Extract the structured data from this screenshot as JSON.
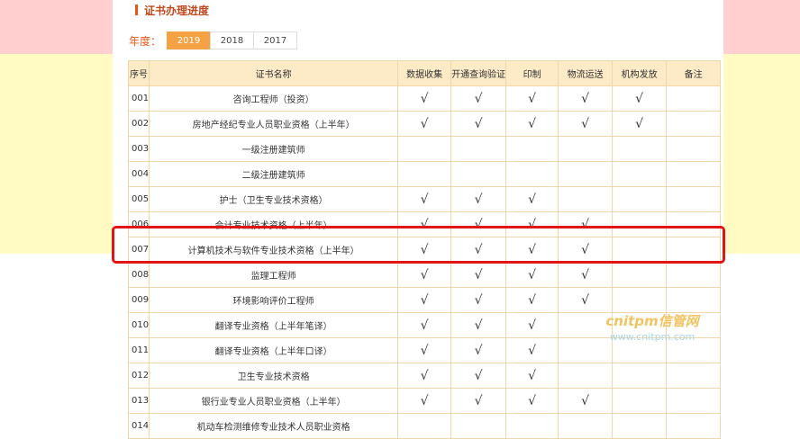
{
  "page": {
    "title": "证书办理进度"
  },
  "year_filter": {
    "label": "年度：",
    "years": [
      "2019",
      "2018",
      "2017"
    ],
    "selected": "2019"
  },
  "table": {
    "columns": [
      "序号",
      "证书名称",
      "数据收集",
      "开通查询验证",
      "印制",
      "物流运送",
      "机构发放",
      "备注"
    ],
    "check_symbol": "√",
    "rows": [
      {
        "no": "001",
        "name": "咨询工程师（投资）",
        "steps": [
          true,
          true,
          true,
          true,
          true
        ],
        "note": ""
      },
      {
        "no": "002",
        "name": "房地产经纪专业人员职业资格（上半年）",
        "steps": [
          true,
          true,
          true,
          true,
          true
        ],
        "note": ""
      },
      {
        "no": "003",
        "name": "一级注册建筑师",
        "steps": [
          false,
          false,
          false,
          false,
          false
        ],
        "note": ""
      },
      {
        "no": "004",
        "name": "二级注册建筑师",
        "steps": [
          false,
          false,
          false,
          false,
          false
        ],
        "note": ""
      },
      {
        "no": "005",
        "name": "护士（卫生专业技术资格）",
        "steps": [
          true,
          true,
          true,
          false,
          false
        ],
        "note": ""
      },
      {
        "no": "006",
        "name": "会计专业技术资格（上半年）",
        "steps": [
          true,
          true,
          true,
          true,
          false
        ],
        "note": ""
      },
      {
        "no": "007",
        "name": "计算机技术与软件专业技术资格（上半年）",
        "steps": [
          true,
          true,
          true,
          true,
          false
        ],
        "note": "",
        "highlighted": true
      },
      {
        "no": "008",
        "name": "监理工程师",
        "steps": [
          true,
          true,
          true,
          true,
          false
        ],
        "note": ""
      },
      {
        "no": "009",
        "name": "环境影响评价工程师",
        "steps": [
          true,
          true,
          true,
          true,
          false
        ],
        "note": ""
      },
      {
        "no": "010",
        "name": "翻译专业资格（上半年笔译）",
        "steps": [
          true,
          true,
          true,
          false,
          false
        ],
        "note": ""
      },
      {
        "no": "011",
        "name": "翻译专业资格（上半年口译）",
        "steps": [
          true,
          true,
          true,
          false,
          false
        ],
        "note": ""
      },
      {
        "no": "012",
        "name": "卫生专业技术资格",
        "steps": [
          true,
          true,
          true,
          false,
          false
        ],
        "note": ""
      },
      {
        "no": "013",
        "name": "银行业专业人员职业资格（上半年）",
        "steps": [
          true,
          true,
          true,
          true,
          false
        ],
        "note": ""
      },
      {
        "no": "014",
        "name": "机动车检测维修专业技术人员职业资格",
        "steps": [
          false,
          false,
          false,
          false,
          false
        ],
        "note": ""
      }
    ]
  },
  "watermark": {
    "main": "cnitpm信管网",
    "sub": "www.cnitpm.com"
  },
  "colors": {
    "accent": "#f5a244",
    "title": "#c0481d",
    "header_bg": "#fdeac7",
    "border": "#f0d6a8",
    "highlight": "#e01616"
  }
}
